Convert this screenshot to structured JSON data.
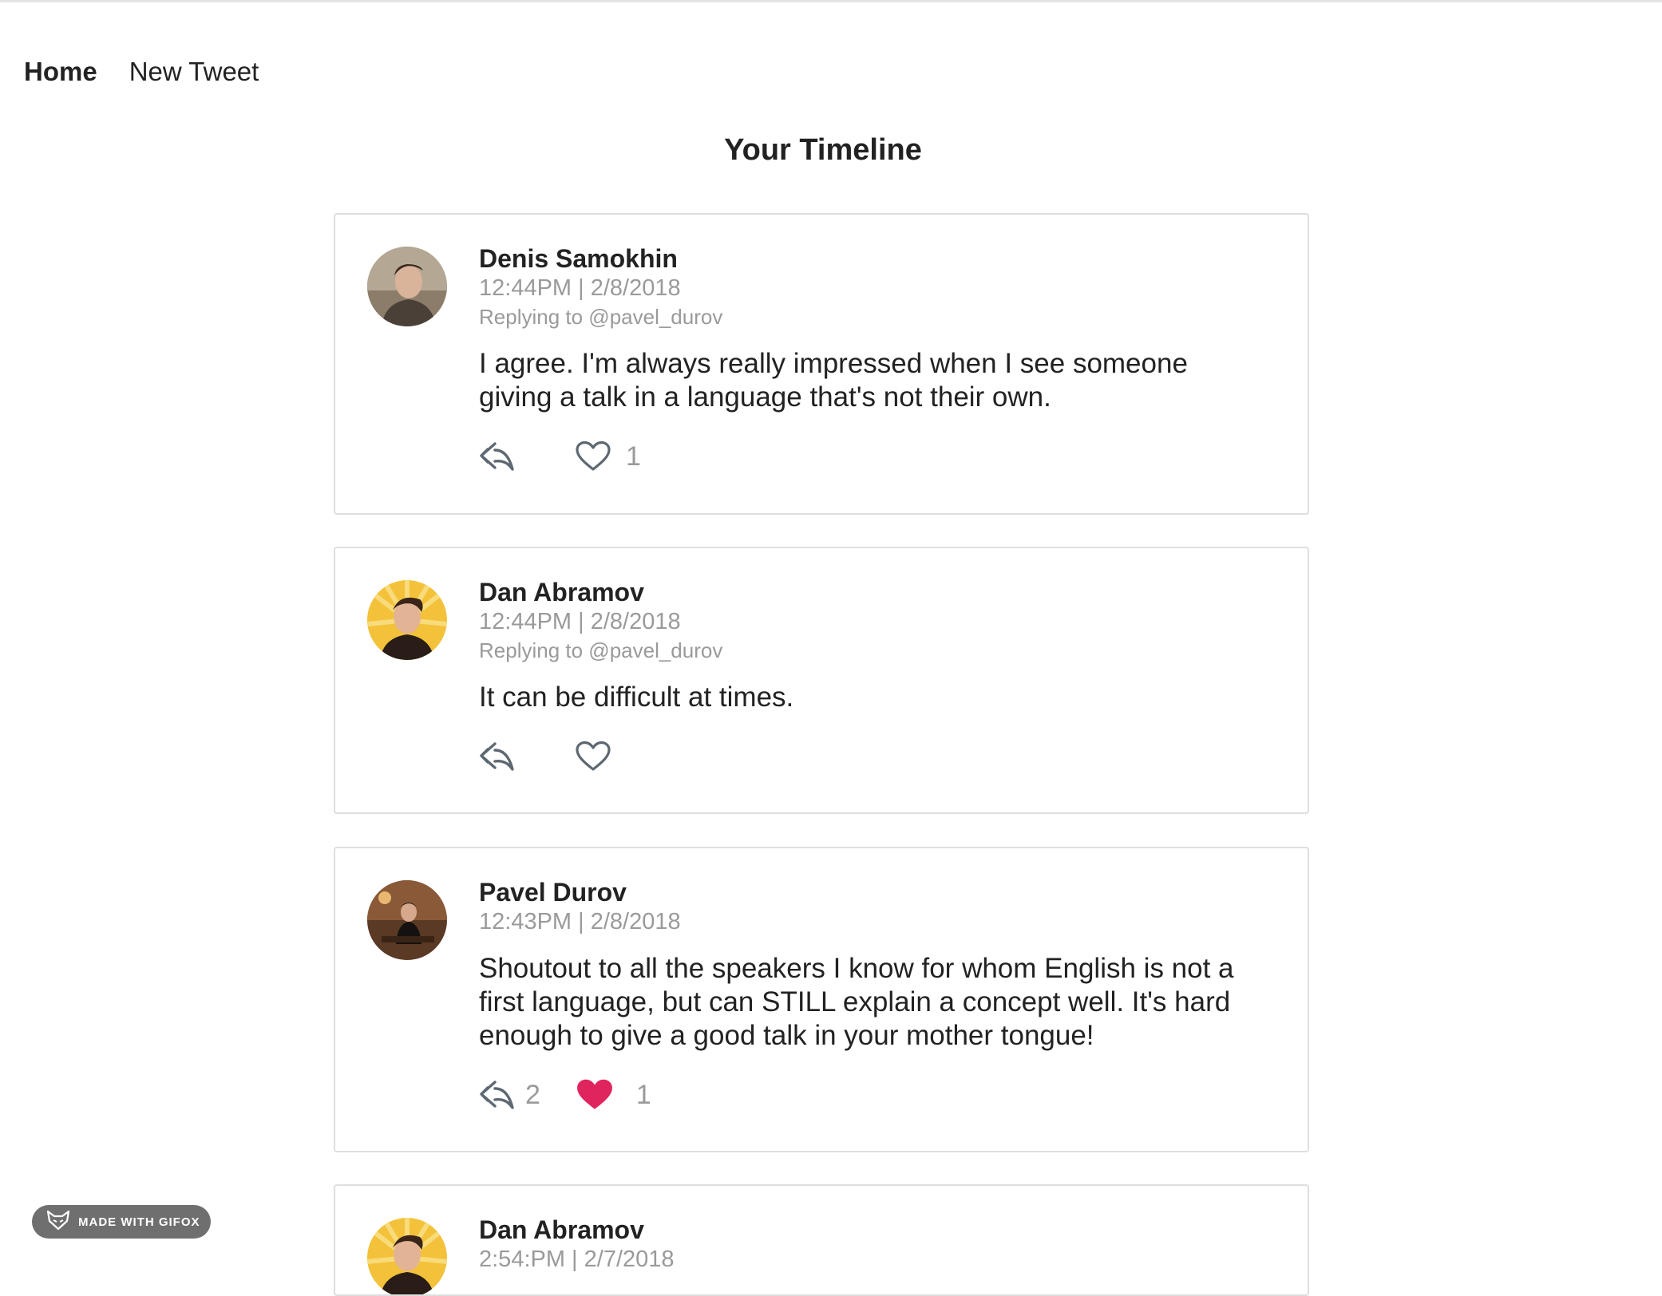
{
  "nav": {
    "home": "Home",
    "new_tweet": "New Tweet"
  },
  "page": {
    "title": "Your Timeline"
  },
  "tweets": [
    {
      "author": "Denis Samokhin",
      "time": "12:44PM | 2/8/2018",
      "reply_to": "Replying to @pavel_durov",
      "text": "I agree. I'm always really impressed when I see someone giving a talk in a language that's not their own.",
      "reply_count": "",
      "likes": "1",
      "liked": false
    },
    {
      "author": "Dan Abramov",
      "time": "12:44PM | 2/8/2018",
      "reply_to": "Replying to @pavel_durov",
      "text": "It can be difficult at times.",
      "reply_count": "",
      "likes": "",
      "liked": false
    },
    {
      "author": "Pavel Durov",
      "time": "12:43PM | 2/8/2018",
      "reply_to": "",
      "text": "Shoutout to all the speakers I know for whom English is not a first language, but can STILL explain a concept well. It's hard enough to give a good talk in your mother tongue!",
      "reply_count": "2",
      "likes": "1",
      "liked": true
    },
    {
      "author": "Dan Abramov",
      "time": "2:54:PM | 2/7/2018"
    }
  ],
  "badge": {
    "label": "MADE WITH GIFOX"
  },
  "colors": {
    "like_active": "#e0245e",
    "muted": "#9a9a9a",
    "border": "#dedede"
  }
}
